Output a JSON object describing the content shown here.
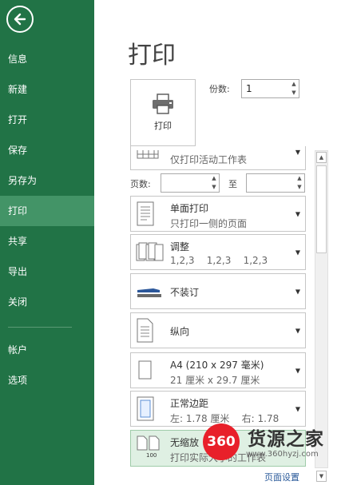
{
  "sidebar": {
    "back_icon": "back-arrow-icon",
    "items": [
      {
        "label": "信息"
      },
      {
        "label": "新建"
      },
      {
        "label": "打开"
      },
      {
        "label": "保存"
      },
      {
        "label": "另存为"
      },
      {
        "label": "打印",
        "active": true
      },
      {
        "label": "共享"
      },
      {
        "label": "导出"
      },
      {
        "label": "关闭"
      },
      {
        "label": "帐户"
      },
      {
        "label": "选项"
      }
    ],
    "bg_color": "#217346",
    "active_color": "#439467"
  },
  "main": {
    "title": "打印",
    "print_button": {
      "label": "打印",
      "icon": "printer-icon"
    },
    "copies": {
      "label": "份数:",
      "value": "1"
    },
    "pages": {
      "label": "页数:",
      "to_label": "至",
      "from_value": "",
      "to_value": ""
    },
    "options": [
      {
        "id": "scope",
        "title": "",
        "subtitle": "仅打印活动工作表",
        "icon": "sheet-icon"
      },
      {
        "id": "sides",
        "title": "单面打印",
        "subtitle": "只打印一侧的页面",
        "icon": "single-page-icon"
      },
      {
        "id": "collate",
        "title": "调整",
        "subtitle": "1,2,3    1,2,3    1,2,3",
        "icon": "collate-icon"
      },
      {
        "id": "staple",
        "title": "不装订",
        "subtitle": "",
        "icon": "stapler-icon"
      },
      {
        "id": "orientation",
        "title": "纵向",
        "subtitle": "",
        "icon": "portrait-icon"
      },
      {
        "id": "paper",
        "title": "A4 (210 x 297 毫米)",
        "subtitle": "21 厘米 x 29.7 厘米",
        "icon": "paper-icon"
      },
      {
        "id": "margins",
        "title": "正常边距",
        "subtitle": "左: 1.78 厘米    右: 1.78",
        "icon": "margins-icon"
      },
      {
        "id": "scaling",
        "title": "无缩放",
        "subtitle": "打印实际大小的工作表",
        "icon": "scaling-icon",
        "icon_text": "100"
      }
    ],
    "page_setup_link": "页面设置"
  },
  "watermark": {
    "badge": "360",
    "name": "货源之家",
    "url": "www.360hyzj.com"
  }
}
